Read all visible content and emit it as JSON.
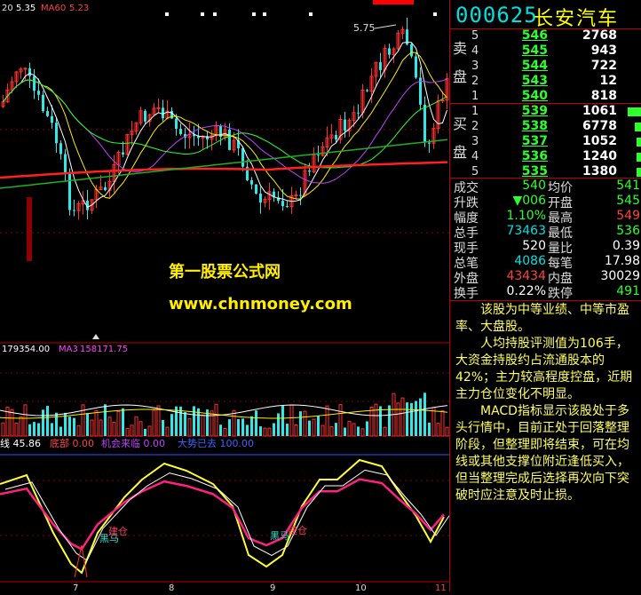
{
  "stock": {
    "code": "000625",
    "name": "长安汽车"
  },
  "main_chart": {
    "top_legend_prefix": "20",
    "top_legend_value": "5.35",
    "ma60_label": "MA60",
    "ma60_value": "5.23",
    "high_label": "5.75",
    "watermark_title": "第一股票公式网",
    "watermark_url": "www.chnmoney.com"
  },
  "volume_chart": {
    "vol_value": "179354.00",
    "ma3_label": "MA3",
    "ma3_value": "158171.75"
  },
  "indicator": {
    "legend": [
      {
        "text": "线 45.86",
        "color": "#ffffff"
      },
      {
        "text": "底部 0.00",
        "color": "#ff4040"
      },
      {
        "text": "机会来临 0.00",
        "color": "#c040ff"
      },
      {
        "text": "大势已去 100.00",
        "color": "#4060ff"
      }
    ],
    "annotations": [
      "黑马",
      "建仓",
      "黑马",
      "建仓"
    ]
  },
  "x_axis": [
    "7",
    "8",
    "9",
    "10",
    "11"
  ],
  "order_book": {
    "sell_label": [
      "卖",
      "盘"
    ],
    "buy_label": [
      "买",
      "盘"
    ],
    "asks": [
      {
        "level": "5",
        "price": "546",
        "volume": "2768"
      },
      {
        "level": "4",
        "price": "545",
        "volume": "943"
      },
      {
        "level": "3",
        "price": "544",
        "volume": "722"
      },
      {
        "level": "2",
        "price": "543",
        "volume": "12"
      },
      {
        "level": "1",
        "price": "540",
        "volume": "818"
      }
    ],
    "bids": [
      {
        "level": "1",
        "price": "539",
        "volume": "1061"
      },
      {
        "level": "2",
        "price": "538",
        "volume": "6778"
      },
      {
        "level": "3",
        "price": "537",
        "volume": "1052"
      },
      {
        "level": "4",
        "price": "536",
        "volume": "1240"
      },
      {
        "level": "5",
        "price": "535",
        "volume": "1380"
      }
    ]
  },
  "quote": [
    {
      "l1": "成交",
      "v1": "540",
      "c1": "#2cff2c",
      "l2": "均价",
      "v2": "541",
      "c2": "#2cff2c"
    },
    {
      "l1": "升跌",
      "v1": "▼006",
      "c1": "#2cff2c",
      "l2": "开盘",
      "v2": "545",
      "c2": "#2cff2c"
    },
    {
      "l1": "幅度",
      "v1": "1.10%",
      "c1": "#2cff2c",
      "l2": "最高",
      "v2": "549",
      "c2": "#ff4040"
    },
    {
      "l1": "总手",
      "v1": "73463",
      "c1": "#00e0e0",
      "l2": "最低",
      "v2": "536",
      "c2": "#2cff2c"
    },
    {
      "l1": "现手",
      "v1": "520",
      "c1": "#ffffff",
      "l2": "量比",
      "v2": "0.39",
      "c2": "#ffffff"
    },
    {
      "l1": "总笔",
      "v1": "4086",
      "c1": "#00e0e0",
      "l2": "每笔",
      "v2": "17.98",
      "c2": "#ffffff"
    },
    {
      "l1": "外盘",
      "v1": "43434",
      "c1": "#ff4040",
      "l2": "内盘",
      "v2": "30029",
      "c2": "#ffffff"
    },
    {
      "l1": "换手",
      "v1": "0.22%",
      "c1": "#ffffff",
      "l2": "跌停",
      "v2": "491",
      "c2": "#2cff2c"
    }
  ],
  "description": [
    "该股为中等业绩、中等市盈率、大盘股。",
    "人均持股评测值为106手，大资金持股约占流通股本的42%；主力较高程度控盘，近期主力仓位变化不明显。",
    "MACD指标显示该股处于多头行情中，目前正处于回落整理阶段，但整理即将结束，可在均线或其他支撑位附近逢低买入，但当整理完成后选择再次向下突破时应注意及时止损。"
  ]
}
